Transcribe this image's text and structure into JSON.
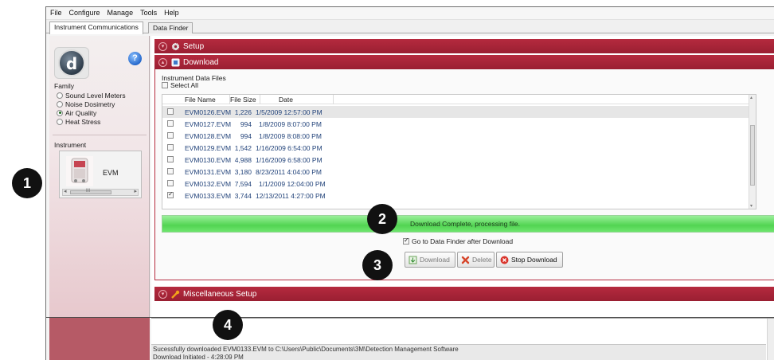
{
  "menu": [
    "File",
    "Configure",
    "Manage",
    "Tools",
    "Help"
  ],
  "tabs": [
    "Instrument Communications",
    "Data Finder"
  ],
  "left_panel": {
    "family_label": "Family",
    "families": [
      {
        "label": "Sound Level Meters",
        "selected": false
      },
      {
        "label": "Noise Dosimetry",
        "selected": false
      },
      {
        "label": "Air Quality",
        "selected": true
      },
      {
        "label": "Heat Stress",
        "selected": false
      }
    ],
    "instrument_label": "Instrument",
    "instrument_name": "EVM",
    "scroll_glyph": "III"
  },
  "sections": {
    "setup": "Setup",
    "download": "Download",
    "misc": "Miscellaneous Setup"
  },
  "download": {
    "files_label": "Instrument Data Files",
    "select_all": "Select All",
    "columns": [
      "File Name",
      "File Size",
      "Date"
    ],
    "rows": [
      {
        "name": "EVM0126.EVM",
        "size": "1,226",
        "date": "1/5/2009 12:57:00 PM",
        "checked": false
      },
      {
        "name": "EVM0127.EVM",
        "size": "994",
        "date": "1/8/2009 8:07:00 PM",
        "checked": false
      },
      {
        "name": "EVM0128.EVM",
        "size": "994",
        "date": "1/8/2009 8:08:00 PM",
        "checked": false
      },
      {
        "name": "EVM0129.EVM",
        "size": "1,542",
        "date": "1/16/2009 6:54:00 PM",
        "checked": false
      },
      {
        "name": "EVM0130.EVM",
        "size": "4,988",
        "date": "1/16/2009 6:58:00 PM",
        "checked": false
      },
      {
        "name": "EVM0131.EVM",
        "size": "3,180",
        "date": "8/23/2011 4:04:00 PM",
        "checked": false
      },
      {
        "name": "EVM0132.EVM",
        "size": "7,594",
        "date": "1/1/2009 12:04:00 PM",
        "checked": false
      },
      {
        "name": "EVM0133.EVM",
        "size": "3,744",
        "date": "12/13/2011 4:27:00 PM",
        "checked": true
      }
    ],
    "progress_text": "Download Complete, processing file.",
    "progress_fraction": 1.0,
    "goto_finder": "Go to Data Finder after Download",
    "buttons": {
      "download": "Download",
      "delete": "Delete",
      "stop": "Stop Download"
    }
  },
  "log": [
    "Sucessfully downloaded EVM0133.EVM to C:\\Users\\Public\\Documents\\3M\\Detection Management Software",
    "Download Initiated - 4:28:09 PM"
  ],
  "callouts": [
    "1",
    "2",
    "3",
    "4"
  ],
  "colors": {
    "accent": "#a8233a",
    "progress": "#52d452",
    "callout": "#111111"
  }
}
